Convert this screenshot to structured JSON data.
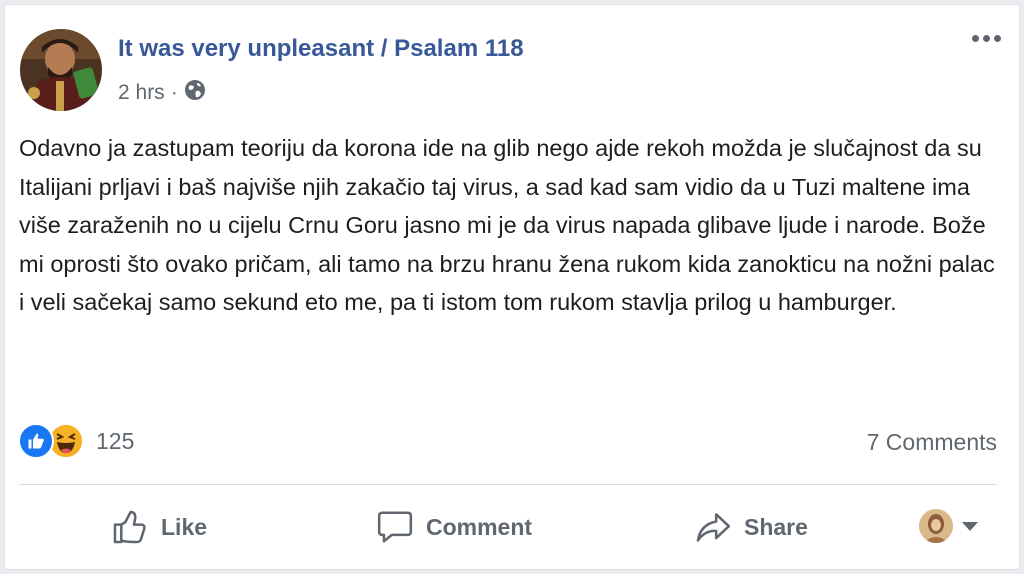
{
  "post": {
    "author": "It was very unpleasant / Psalam 118",
    "time": "2 hrs",
    "separator": "·",
    "privacy_icon": "globe-icon",
    "text": "Odavno ja zastupam teoriju da korona ide na glib nego ajde rekoh možda je slučajnost da su Italijani prljavi i baš najviše njih zakačio taj virus, a sad kad sam vidio da u Tuzi maltene ima više zaraženih no u cijelu Crnu Goru jasno mi je da virus napada glibave ljude i narode. Bože mi oprosti što ovako pričam, ali tamo na brzu hranu žena rukom kida zanokticu na nožni palac i veli sačekaj samo sekund eto me, pa ti istom tom rukom stavlja prilog u hamburger."
  },
  "reactions": {
    "icons": [
      "like-icon",
      "haha-icon"
    ],
    "count": "125",
    "comments": "7 Comments"
  },
  "actions": {
    "like": "Like",
    "comment": "Comment",
    "share": "Share"
  },
  "colors": {
    "author": "#385898",
    "like_blue": "#1877f2",
    "haha_yellow": "#f7b125",
    "muted": "#606770"
  }
}
